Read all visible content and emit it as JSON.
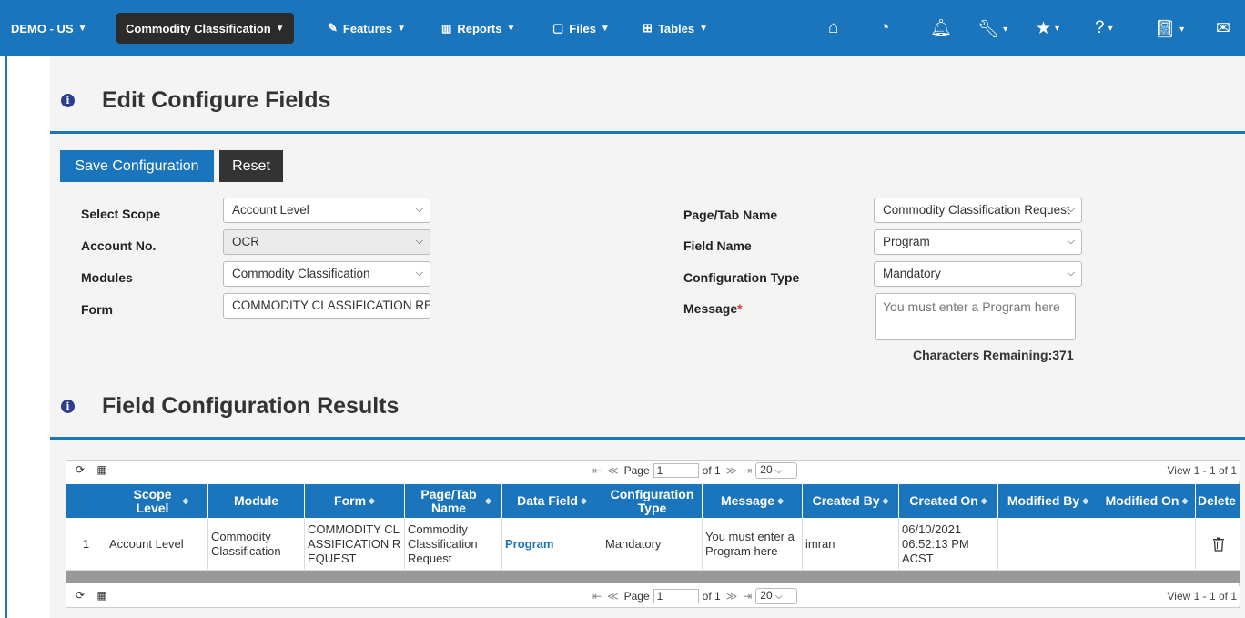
{
  "nav": {
    "account": "DEMO - US",
    "module": "Commodity Classification",
    "features": "Features",
    "reports": "Reports",
    "files": "Files",
    "tables": "Tables"
  },
  "page": {
    "title": "Edit Configure Fields",
    "results_title": "Field Configuration Results"
  },
  "buttons": {
    "save": "Save Configuration",
    "reset": "Reset"
  },
  "form": {
    "scope_label": "Select Scope",
    "scope_value": "Account Level",
    "account_label": "Account No.",
    "account_value": "OCR",
    "modules_label": "Modules",
    "modules_value": "Commodity Classification",
    "form_label": "Form",
    "form_value": "COMMODITY CLASSIFICATION REQUEST",
    "page_label": "Page/Tab Name",
    "page_value": "Commodity Classification Request",
    "field_label": "Field Name",
    "field_value": "Program",
    "config_label": "Configuration Type",
    "config_value": "Mandatory",
    "message_label": "Message",
    "message_required": "*",
    "message_placeholder": "You must enter a Program here",
    "chars_remaining": "Characters Remaining:371"
  },
  "grid": {
    "pager": {
      "page_label": "Page",
      "page_value": "1",
      "of_label": "of 1",
      "rows_value": "20",
      "view_text": "View 1 - 1 of 1"
    },
    "columns": [
      "Scope Level",
      "Module",
      "Form",
      "Page/Tab Name",
      "Data Field",
      "Configuration Type",
      "Message",
      "Created By",
      "Created On",
      "Modified By",
      "Modified On",
      "Delete"
    ],
    "rows": [
      {
        "num": "1",
        "scope": "Account Level",
        "module": "Commodity Classification",
        "form": "COMMODITY CLASSIFICATION REQUEST",
        "page": "Commodity Classification Request",
        "field": "Program",
        "config": "Mandatory",
        "message": "You must enter a Program here",
        "created_by": "imran",
        "created_on": "06/10/2021 06:52:13 PM ACST",
        "modified_by": "",
        "modified_on": ""
      }
    ]
  },
  "colors": {
    "primary": "#1b75bc",
    "dark": "#2b2b2b",
    "background": "#f4f4f4"
  }
}
